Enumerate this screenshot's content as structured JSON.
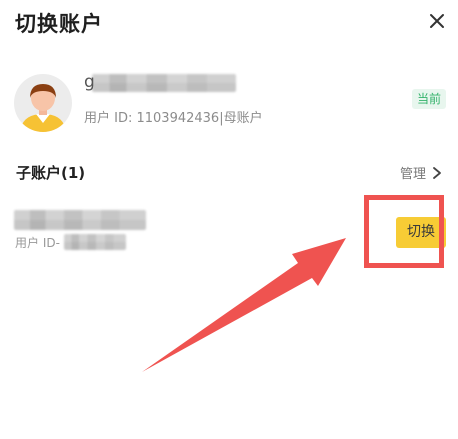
{
  "dialog": {
    "title": "切换账户",
    "close_icon": "close-icon"
  },
  "main_account": {
    "avatar_icon": "avatar-icon",
    "username_visible": "g",
    "uid_text": "用户 ID: 1103942436|母账户",
    "badge": "当前"
  },
  "sub_accounts": {
    "heading": "子账户(1)",
    "manage_label": "管理",
    "manage_icon": "chevron-right-icon",
    "items": [
      {
        "uid_prefix": "用户 ID-",
        "switch_label": "切换"
      }
    ]
  },
  "annotation": {
    "highlight_color": "#ef5350",
    "arrow_color": "#ef5350"
  },
  "colors": {
    "accent_yellow": "#f7cc35",
    "badge_green": "#33b36b",
    "badge_bg": "#e8f6ee"
  }
}
